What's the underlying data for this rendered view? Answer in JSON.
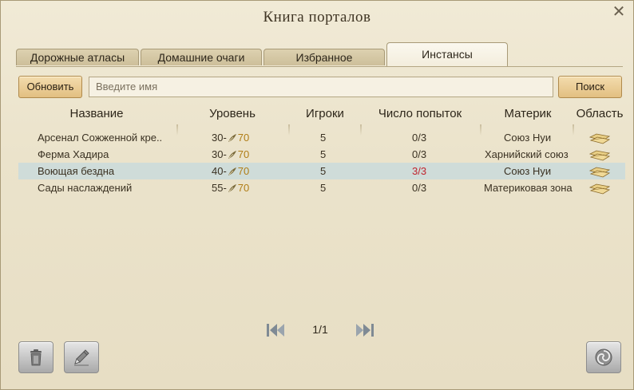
{
  "window": {
    "title": "Книга порталов"
  },
  "tabs": [
    {
      "label": "Дорожные атласы"
    },
    {
      "label": "Домашние очаги"
    },
    {
      "label": "Избранное"
    },
    {
      "label": "Инстансы"
    }
  ],
  "toolbar": {
    "refresh_label": "Обновить",
    "search_placeholder": "Введите имя",
    "search_label": "Поиск"
  },
  "table": {
    "columns": [
      "Название",
      "Уровень",
      "Игроки",
      "Число попыток",
      "Материк",
      "Область"
    ],
    "rows": [
      {
        "name": "Арсенал Сожженной кре..",
        "level_min": "30-",
        "level_max": "70",
        "players": "5",
        "attempts": "0/3",
        "continent": "Союз Нуи"
      },
      {
        "name": "Ферма Хадира",
        "level_min": "30-",
        "level_max": "70",
        "players": "5",
        "attempts": "0/3",
        "continent": "Харнийский союз"
      },
      {
        "name": "Воющая бездна",
        "level_min": "40-",
        "level_max": "70",
        "players": "5",
        "attempts": "3/3",
        "continent": "Союз Нуи"
      },
      {
        "name": "Сады наслаждений",
        "level_min": "55-",
        "level_max": "70",
        "players": "5",
        "attempts": "0/3",
        "continent": "Материковая зона"
      }
    ]
  },
  "pager": {
    "page": "1/1"
  },
  "colors": {
    "accent_gold": "#b07d16",
    "attempts_full": "#c0242e",
    "selected_row": "#cfdcd9"
  }
}
